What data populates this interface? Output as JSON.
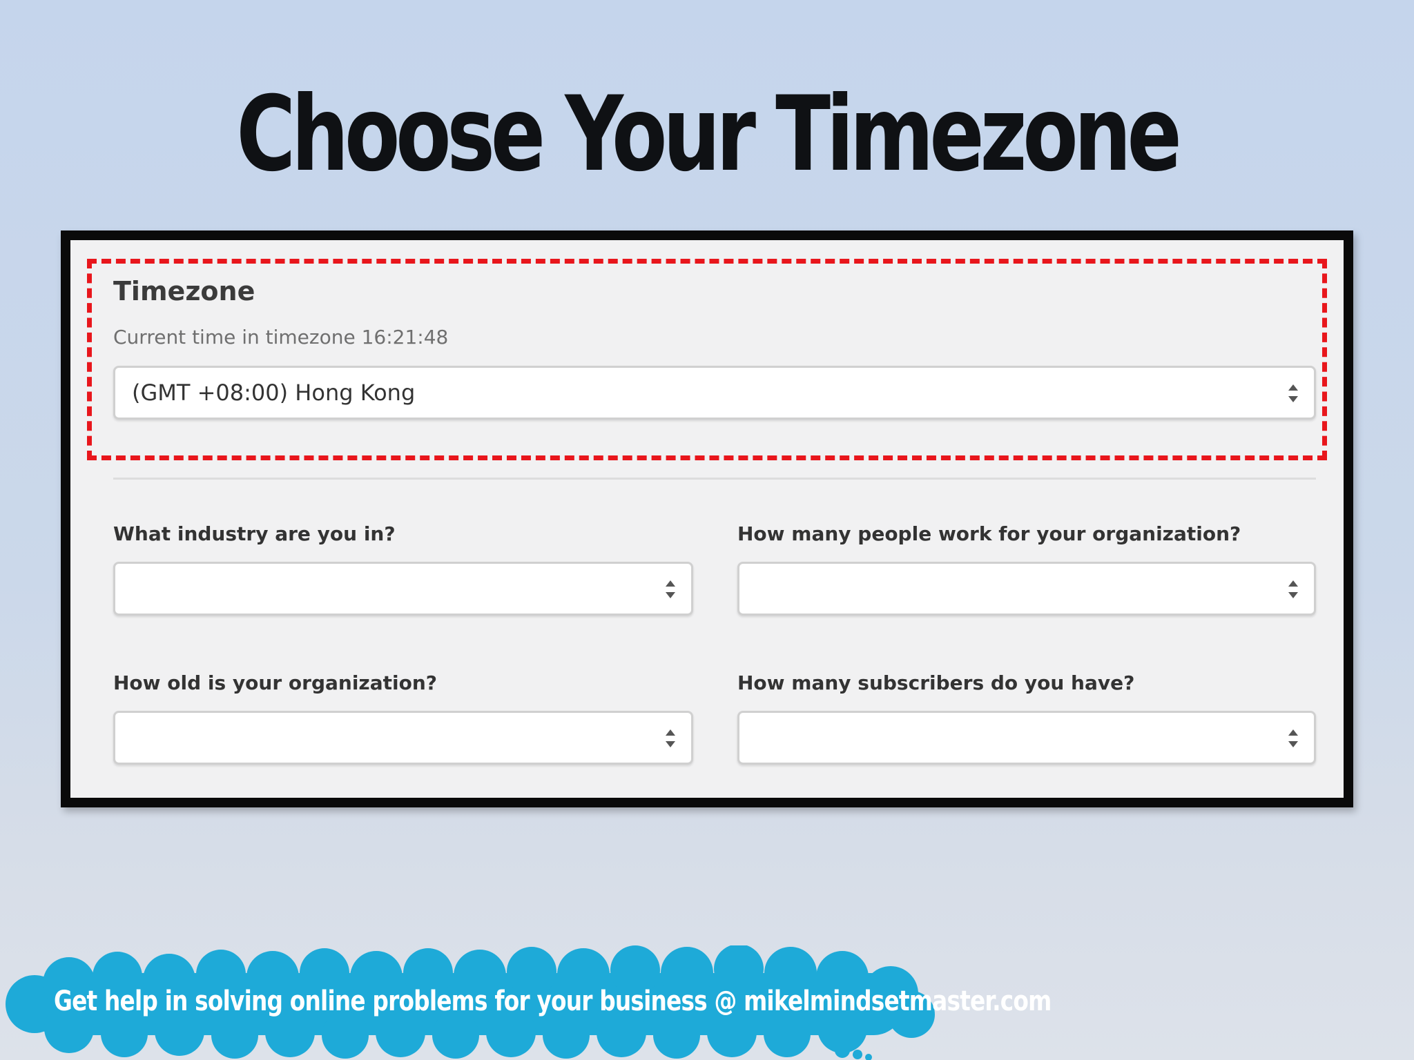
{
  "slide": {
    "title": "Choose Your Timezone"
  },
  "timezone": {
    "title": "Timezone",
    "current_time_label": "Current time in timezone 16:21:48",
    "selected": "(GMT +08:00) Hong Kong"
  },
  "questions": [
    {
      "label": "What industry are you in?",
      "value": ""
    },
    {
      "label": "How many people work for your organization?",
      "value": ""
    },
    {
      "label": "How old is your organization?",
      "value": ""
    },
    {
      "label": "How many subscribers do you have?",
      "value": ""
    }
  ],
  "footer": {
    "banner_text": "Get help in solving online problems for your business @ mikelmindsetmaster.com"
  },
  "colors": {
    "background": "#c5d5ec",
    "highlight": "#e8161c",
    "cloud": "#1eaad8",
    "panel_border": "#0a0a0a"
  },
  "icons": {
    "select_arrows": "up-down-chevron-icon",
    "cloud": "cloud-banner-icon"
  }
}
